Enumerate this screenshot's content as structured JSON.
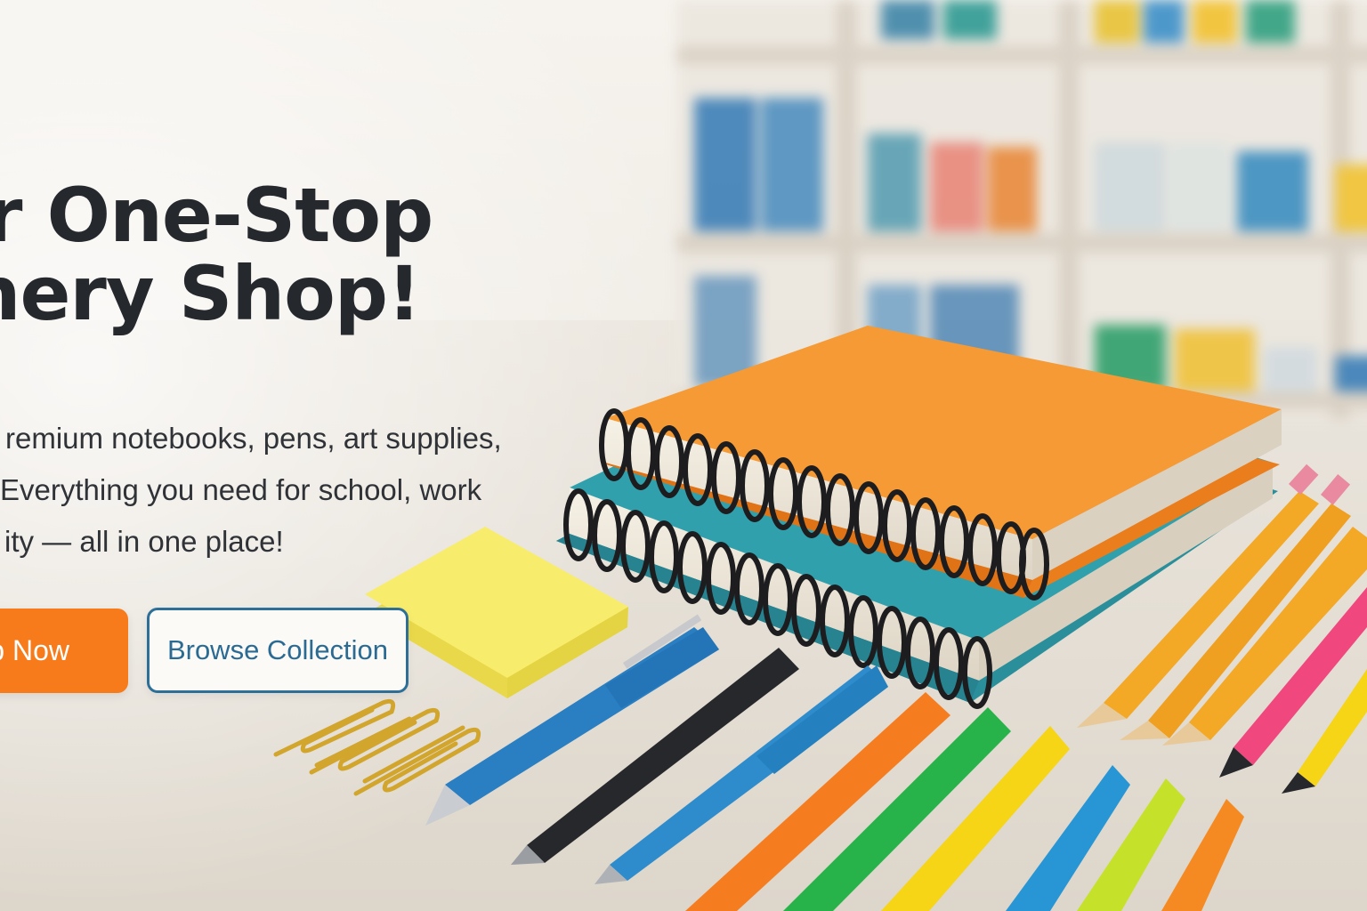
{
  "hero": {
    "headline_line1": "r One-Stop",
    "headline_line2": "tionery Shop!",
    "subtext_line1": "remium notebooks, pens, art supplies,",
    "subtext_line2": "Everything you need for school, work",
    "subtext_line3": "ity — all in one place!",
    "primary_button": "p Now",
    "secondary_button": "Browse Collection"
  },
  "colors": {
    "accent_orange": "#f77b1a",
    "secondary_blue": "#2d6f96",
    "text_dark": "#25282c"
  }
}
